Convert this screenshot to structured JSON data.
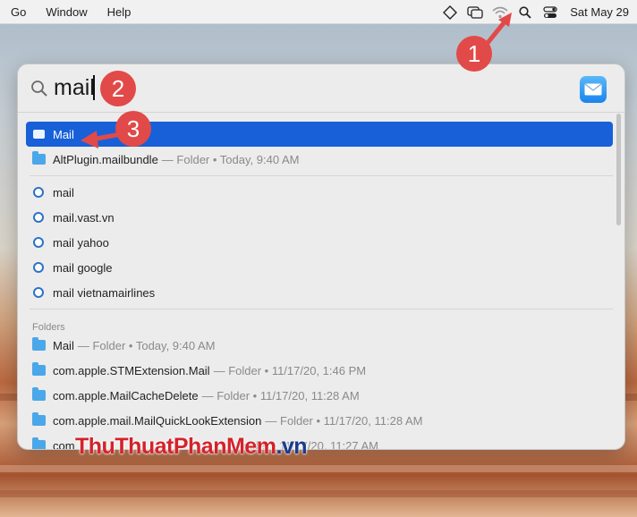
{
  "menubar": {
    "items": [
      "Go",
      "Window",
      "Help"
    ],
    "clock": "Sat May 29"
  },
  "spotlight": {
    "query": "mail",
    "top_hits": [
      {
        "name": "Mail",
        "meta": "",
        "icon": "mail-app-icon",
        "selected": true
      },
      {
        "name": "AltPlugin.mailbundle",
        "meta": "— Folder • Today, 9:40 AM",
        "icon": "folder-icon"
      }
    ],
    "suggestions": [
      {
        "name": "mail",
        "icon": "web-search-icon"
      },
      {
        "name": "mail.vast.vn",
        "icon": "web-search-icon"
      },
      {
        "name": "mail yahoo",
        "icon": "web-search-icon"
      },
      {
        "name": "mail google",
        "icon": "web-search-icon"
      },
      {
        "name": "mail vietnamairlines",
        "icon": "web-search-icon"
      }
    ],
    "folders_header": "Folders",
    "folders": [
      {
        "name": "Mail",
        "meta": "— Folder • Today, 9:40 AM"
      },
      {
        "name": "com.apple.STMExtension.Mail",
        "meta": "— Folder • 11/17/20, 1:46 PM"
      },
      {
        "name": "com.apple.MailCacheDelete",
        "meta": "— Folder • 11/17/20, 11:28 AM"
      },
      {
        "name": "com.apple.mail.MailQuickLookExtension",
        "meta": "— Folder • 11/17/20, 11:28 AM"
      },
      {
        "name": "com",
        "meta": "Folder • 11/17/20, 11:27 AM"
      }
    ]
  },
  "annotations": {
    "one": "1",
    "two": "2",
    "three": "3"
  },
  "watermark": {
    "main": "ThuThuatPhanMem",
    "suffix": ".vn"
  },
  "colors": {
    "selection": "#1760d8",
    "badge": "#e14a48",
    "watermark": "#d3232b"
  }
}
